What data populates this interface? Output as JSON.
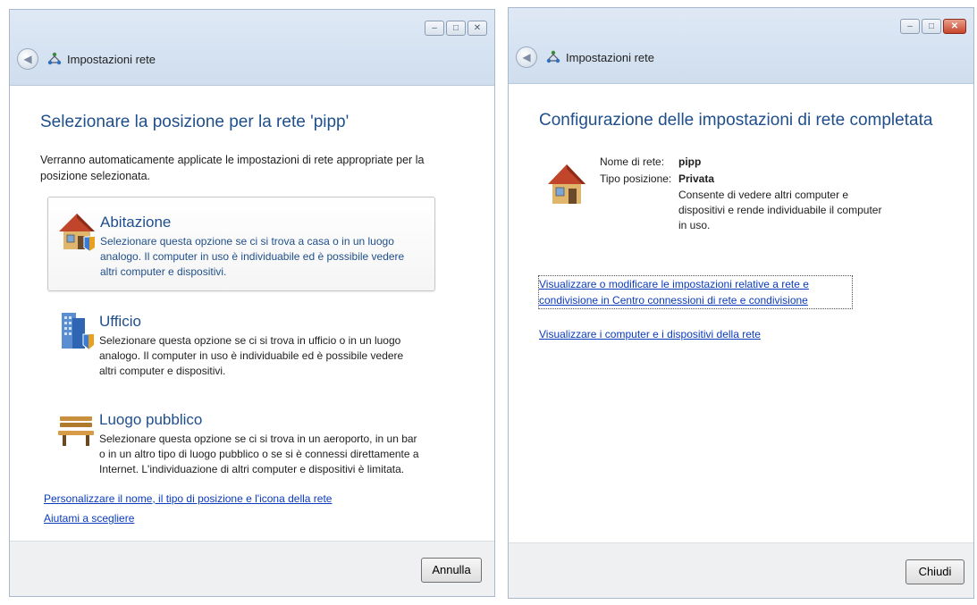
{
  "left": {
    "nav_title": "Impostazioni rete",
    "heading": "Selezionare la posizione per la rete 'pipp'",
    "intro": "Verranno automaticamente applicate le impostazioni di rete appropriate per la posizione selezionata.",
    "options": [
      {
        "title": "Abitazione",
        "desc": "Selezionare questa opzione se ci si trova a casa o in un luogo analogo. Il computer in uso è individuabile ed è possibile vedere altri computer e dispositivi.",
        "icon": "home-icon"
      },
      {
        "title": "Ufficio",
        "desc": "Selezionare questa opzione se ci si trova in ufficio o in un luogo analogo. Il computer in uso è individuabile ed è possibile vedere altri computer e dispositivi.",
        "icon": "office-building-icon"
      },
      {
        "title": "Luogo pubblico",
        "desc": "Selezionare questa opzione se ci si trova in un aeroporto, in un bar o in un altro tipo di luogo pubblico o se si è connessi direttamente a Internet. L'individuazione di altri computer e dispositivi è limitata.",
        "icon": "park-bench-icon"
      }
    ],
    "link_customize": "Personalizzare il nome, il tipo di posizione e l'icona della rete",
    "link_help": "Aiutami a scegliere",
    "cancel_label": "Annulla"
  },
  "right": {
    "nav_title": "Impostazioni rete",
    "heading": "Configurazione delle impostazioni di rete completata",
    "network_name_label": "Nome di rete:",
    "network_name_value": "pipp",
    "location_type_label": "Tipo posizione:",
    "location_type_value": "Privata",
    "location_desc": "Consente di vedere altri computer e dispositivi e rende individuabile il computer in uso.",
    "link_network_center": "Visualizzare o modificare le impostazioni relative a rete e condivisione in Centro connessioni di rete e condivisione",
    "link_view_computers": "Visualizzare i computer e i dispositivi della rete",
    "close_label": "Chiudi"
  },
  "window_controls": {
    "minimize": "–",
    "maximize": "□",
    "close": "✕"
  },
  "colors": {
    "heading": "#1f4f8b",
    "link": "#0b3bbd",
    "chrome": "#d5e2f1",
    "footer": "#eef0f2"
  }
}
